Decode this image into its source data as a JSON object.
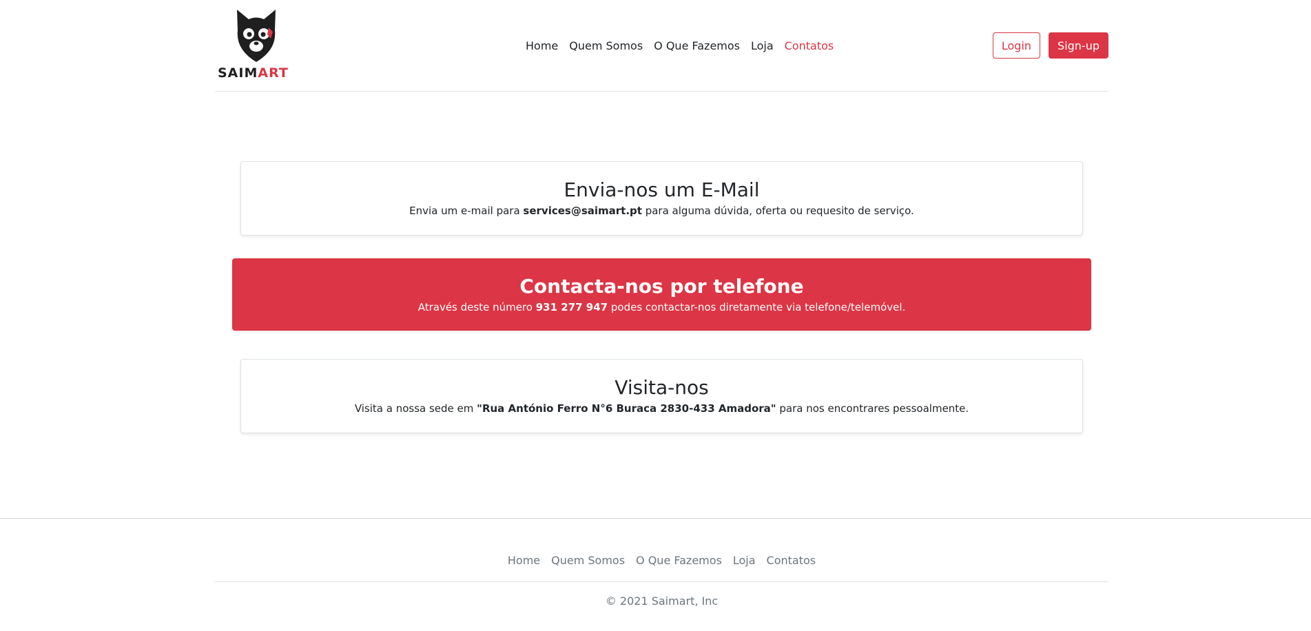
{
  "brand": {
    "name_part1": "SAIM",
    "name_part2": "ART",
    "accent": "#dc3545",
    "logo_icon": "cat-face-icon"
  },
  "nav": {
    "items": [
      {
        "label": "Home"
      },
      {
        "label": "Quem Somos"
      },
      {
        "label": "O Que Fazemos"
      },
      {
        "label": "Loja"
      },
      {
        "label": "Contatos"
      }
    ],
    "active": "Contatos"
  },
  "auth": {
    "login_label": "Login",
    "signup_label": "Sign-up"
  },
  "sections": {
    "email": {
      "title": "Envia-nos um E-Mail",
      "text_before": "Envia um e-mail para ",
      "highlight": "services@saimart.pt",
      "text_after": " para alguma dúvida, oferta ou requesito de serviço."
    },
    "phone": {
      "title": "Contacta-nos por telefone",
      "text_before": "Através deste número ",
      "highlight": "931 277 947",
      "text_after": " podes contactar-nos diretamente via telefone/telemóvel."
    },
    "visit": {
      "title": "Visita-nos",
      "text_before": "Visita a nossa sede em ",
      "highlight": "\"Rua António Ferro N°6 Buraca 2830-433 Amadora\"",
      "text_after": " para nos encontrares pessoalmente."
    }
  },
  "footer": {
    "nav": [
      {
        "label": "Home"
      },
      {
        "label": "Quem Somos"
      },
      {
        "label": "O Que Fazemos"
      },
      {
        "label": "Loja"
      },
      {
        "label": "Contatos"
      }
    ],
    "copyright": "© 2021 Saimart, Inc"
  }
}
